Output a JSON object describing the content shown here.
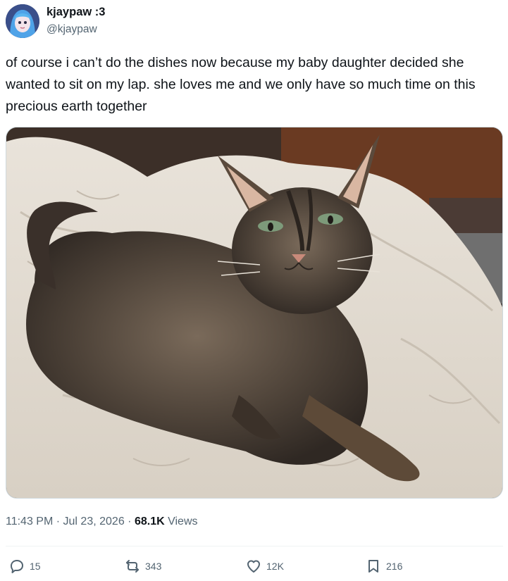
{
  "tweet": {
    "display_name": "kjaypaw :3",
    "handle": "@kjaypaw",
    "avatar_icon": "anime-avatar-icon",
    "text": "of course i can’t do the dishes now because my baby daughter decided she wanted to sit on my lap. she loves me and we only have so much time on this precious earth together",
    "time": "11:43 PM",
    "date": "Jul 23, 2026",
    "separator": "·",
    "views_count": "68.1K",
    "views_label": "Views"
  },
  "actions": {
    "replies": {
      "icon": "reply-icon",
      "count": "15"
    },
    "reposts": {
      "icon": "repost-icon",
      "count": "343"
    },
    "likes": {
      "icon": "heart-icon",
      "count": "12K"
    },
    "bookmarks": {
      "icon": "bookmark-icon",
      "count": "216"
    }
  },
  "colors": {
    "text": "#0f1419",
    "secondary": "#536471",
    "divider": "#eff3f4"
  }
}
